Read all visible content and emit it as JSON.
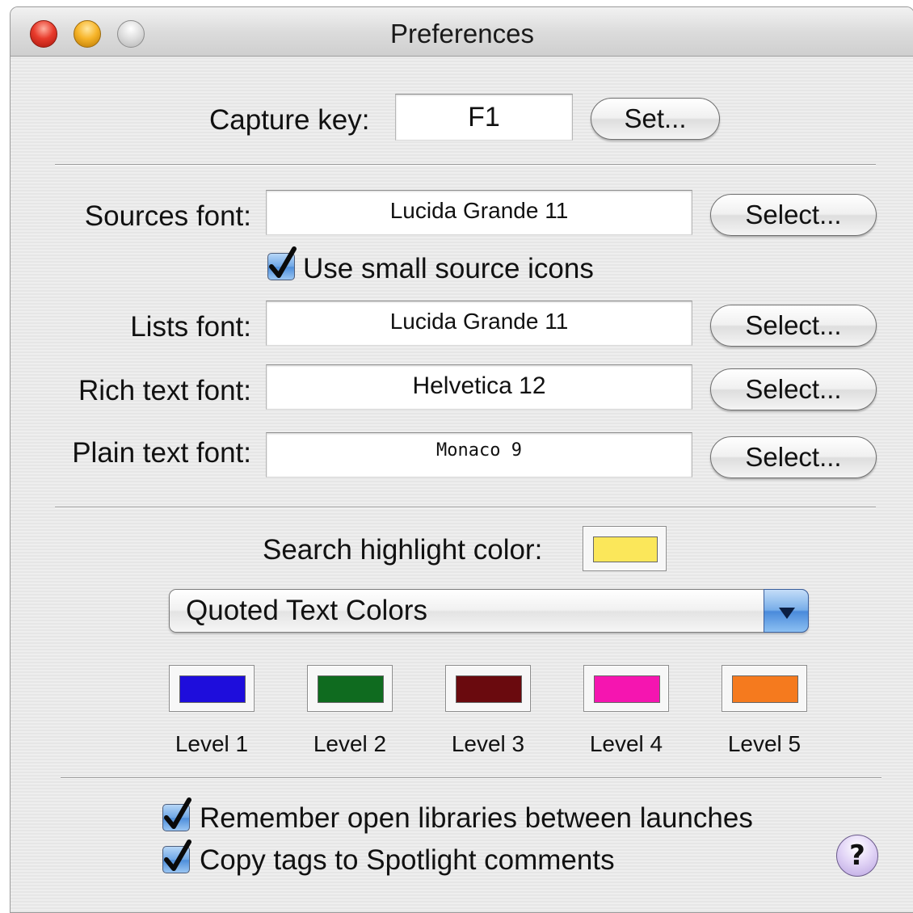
{
  "window": {
    "title": "Preferences"
  },
  "capture": {
    "label": "Capture key:",
    "value": "F1",
    "button": "Set..."
  },
  "fonts": [
    {
      "label": "Sources font:",
      "value": "Lucida Grande 11",
      "button": "Select..."
    },
    {
      "label": "Lists font:",
      "value": "Lucida Grande 11",
      "button": "Select..."
    },
    {
      "label": "Rich text font:",
      "value": "Helvetica 12",
      "button": "Select..."
    },
    {
      "label": "Plain text font:",
      "value": "Monaco 9",
      "button": "Select..."
    }
  ],
  "small_icons": {
    "label": "Use small source icons",
    "checked": true
  },
  "search_highlight": {
    "label": "Search highlight color:",
    "color": "#fbe75a"
  },
  "quoted_popup": {
    "selected": "Quoted Text Colors"
  },
  "levels": [
    {
      "label": "Level 1",
      "color": "#1e0ddc"
    },
    {
      "label": "Level 2",
      "color": "#0f6b1f"
    },
    {
      "label": "Level 3",
      "color": "#6a0a0e"
    },
    {
      "label": "Level 4",
      "color": "#f515b0"
    },
    {
      "label": "Level 5",
      "color": "#f57a1e"
    }
  ],
  "options": [
    {
      "label": "Remember open libraries between launches",
      "checked": true
    },
    {
      "label": "Copy tags to Spotlight comments",
      "checked": true
    }
  ],
  "help": {
    "label": "?"
  }
}
